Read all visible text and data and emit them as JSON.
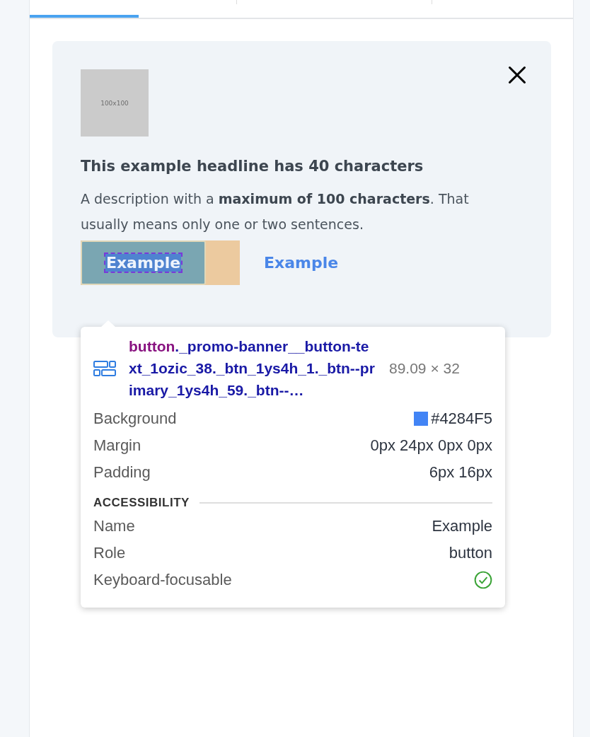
{
  "tabs": [
    {
      "selected": true
    },
    {
      "selected": false
    },
    {
      "selected": false
    }
  ],
  "promo_card": {
    "image": {
      "label": "100x100"
    },
    "headline": "This example headline has 40 characters",
    "description": "A description with a **maximum of 100 characters**. That usually means only one or two sentences.",
    "primary_button": "Example",
    "link_button": "Example"
  },
  "inspector_tooltip": {
    "tag": "button",
    "classes": "._promo-banner__button-text_1ozic_38._btn_1ys4h_1._btn--primary_1ys4h_59._btn--…",
    "size": "89.09 × 32",
    "properties": [
      {
        "kind": "color",
        "label": "Background",
        "value": "#4284F5",
        "color": "#4284f5"
      },
      {
        "kind": "text",
        "label": "Margin",
        "value": "0px 24px 0px 0px"
      },
      {
        "kind": "text",
        "label": "Padding",
        "value": "6px 16px"
      }
    ],
    "section_title": "ACCESSIBILITY",
    "accessibility": [
      {
        "kind": "text",
        "label": "Name",
        "value": "Example"
      },
      {
        "kind": "text",
        "label": "Role",
        "value": "button"
      },
      {
        "kind": "check",
        "label": "Keyboard-focusable",
        "checked": true
      }
    ]
  }
}
